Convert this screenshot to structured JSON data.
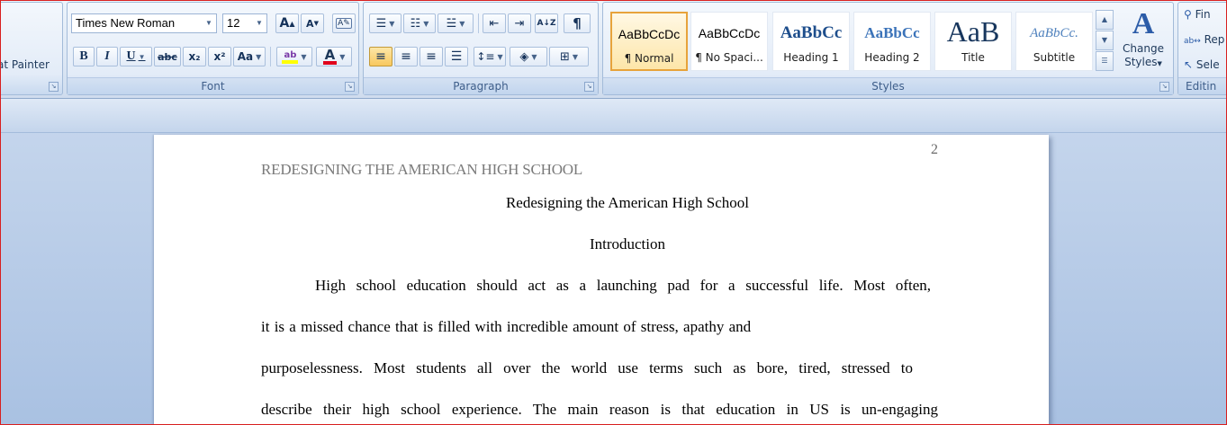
{
  "ribbon": {
    "clipboard": {
      "format_painter_label": "at Painter"
    },
    "font": {
      "group_label": "Font",
      "font_name": "Times New Roman",
      "font_size": "12",
      "bold": "B",
      "italic": "I",
      "underline": "U",
      "strikethrough": "abc",
      "subscript": "x₂",
      "superscript": "x²",
      "change_case": "Aa",
      "grow": "A",
      "shrink": "A",
      "highlight_color": "#ffff00",
      "font_color": "#e0001b"
    },
    "paragraph": {
      "group_label": "Paragraph",
      "pilcrow": "¶",
      "sort": "A↓Z"
    },
    "styles": {
      "group_label": "Styles",
      "gallery": [
        {
          "preview": "AaBbCcDc",
          "name": "¶ Normal",
          "active": true
        },
        {
          "preview": "AaBbCcDc",
          "name": "¶ No Spaci...",
          "active": false
        },
        {
          "preview": "AaBbCc",
          "name": "Heading 1",
          "active": false
        },
        {
          "preview": "AaBbCc",
          "name": "Heading 2",
          "active": false
        },
        {
          "preview": "AaB",
          "name": "Title",
          "active": false
        },
        {
          "preview": "AaBbCc.",
          "name": "Subtitle",
          "active": false
        }
      ],
      "change_styles_line1": "Change",
      "change_styles_line2": "Styles",
      "accent_color": "#2c5ca8"
    },
    "editing": {
      "group_label": "Editin",
      "find": "Fin",
      "replace": "Rep",
      "select": "Sele"
    }
  },
  "document": {
    "page_number": "2",
    "running_header": "REDESIGNING THE AMERICAN HIGH SCHOOL",
    "title": "Redesigning the American High School",
    "heading": "Introduction",
    "lines": [
      "High school education should act as a launching pad for a successful life. Most often,",
      "it is a missed chance that is filled with incredible amount of stress, apathy and",
      "purposelessness. Most students all over the world use terms such as bore, tired, stressed to",
      "describe their high school experience. The main reason is that education in US is un-engaging"
    ]
  }
}
